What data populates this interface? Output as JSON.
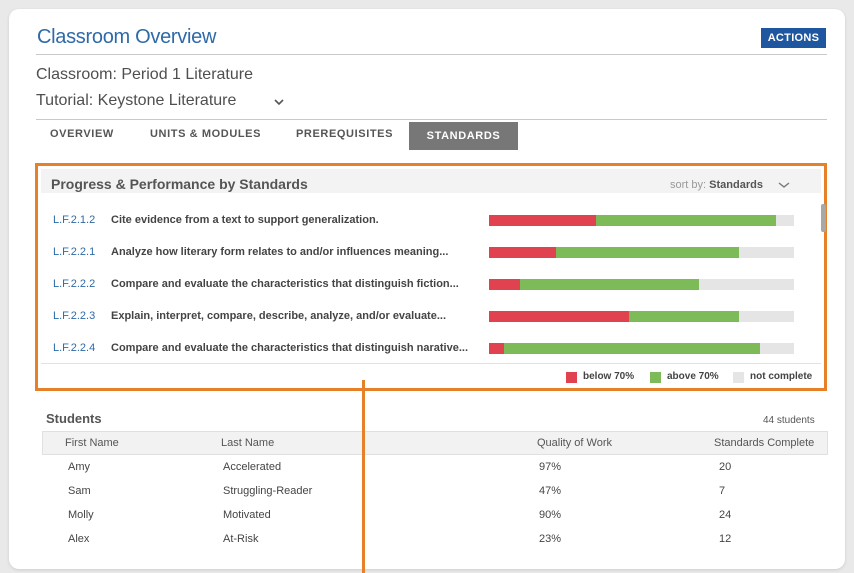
{
  "header": {
    "title": "Classroom Overview",
    "actions_label": "ACTIONS",
    "classroom": "Classroom: Period 1 Literature",
    "tutorial": "Tutorial: Keystone Literature"
  },
  "tabs": {
    "overview": "OVERVIEW",
    "units": "UNITS & MODULES",
    "prereq": "PREREQUISITES",
    "standards": "STANDARDS",
    "active": "standards"
  },
  "standards_panel": {
    "title": "Progress & Performance by Standards",
    "sort_label": "sort by:",
    "sort_value": "Standards",
    "rows": [
      {
        "code": "L.F.2.1.2",
        "desc": "Cite evidence from a text to support generalization.",
        "below": 35,
        "above": 59
      },
      {
        "code": "L.F.2.2.1",
        "desc": "Analyze how literary form relates to and/or influences meaning...",
        "below": 22,
        "above": 60
      },
      {
        "code": "L.F.2.2.2",
        "desc": "Compare and evaluate the characteristics that distinguish fiction...",
        "below": 10,
        "above": 59
      },
      {
        "code": "L.F.2.2.3",
        "desc": "Explain, interpret, compare, describe, analyze, and/or evaluate...",
        "below": 46,
        "above": 36
      },
      {
        "code": "L.F.2.2.4",
        "desc": "Compare and evaluate the characteristics that distinguish narative...",
        "below": 5,
        "above": 84
      }
    ],
    "legend": {
      "below": "below 70%",
      "above": "above 70%",
      "not_complete": "not complete"
    },
    "colors": {
      "below": "#e0424f",
      "above": "#7dbb58",
      "not_complete": "#e5e5e5",
      "accent": "#e6812a"
    }
  },
  "students": {
    "title": "Students",
    "count": "44 students",
    "columns": [
      "First Name",
      "Last Name",
      "Quality of Work",
      "Standards Complete"
    ],
    "rows": [
      [
        "Amy",
        "Accelerated",
        "97%",
        "20"
      ],
      [
        "Sam",
        "Struggling-Reader",
        "47%",
        "7"
      ],
      [
        "Molly",
        "Motivated",
        "90%",
        "24"
      ],
      [
        "Alex",
        "At-Risk",
        "23%",
        "12"
      ]
    ]
  }
}
